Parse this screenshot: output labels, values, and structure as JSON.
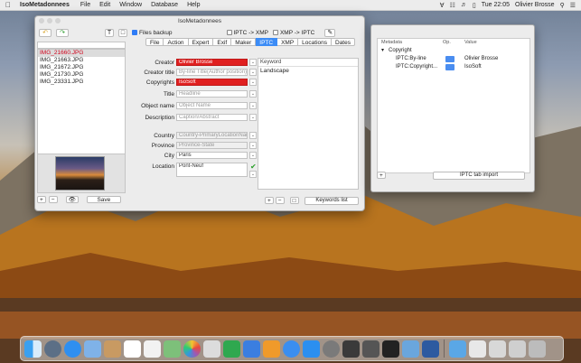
{
  "menubar": {
    "app_name": "IsoMetadonnees",
    "items": [
      "File",
      "Edit",
      "Window",
      "Database",
      "Help"
    ],
    "clock": "Tue 22:05",
    "user": "Olivier Brosse"
  },
  "main_window": {
    "title": "IsoMetadonnees",
    "files_backup_label": "Files backup",
    "iptc_to_xmp_label": "IPTC -> XMP",
    "xmp_to_iptc_label": "XMP -> IPTC",
    "files": [
      "IMG_21660.JPG",
      "IMG_21663.JPG",
      "IMG_21672.JPG",
      "IMG_21730.JPG",
      "IMG_23331.JPG"
    ],
    "save_label": "Save",
    "tabs": [
      "File",
      "Action",
      "Expert",
      "Exif",
      "Maker",
      "IPTC",
      "XMP",
      "Locations",
      "Dates"
    ],
    "active_tab": "IPTC",
    "fields": {
      "creator_label": "Creator",
      "creator_value": "Olivier Brosse",
      "creator_title_label": "Creator title",
      "creator_title_placeholder": "By-line Title(Author position)",
      "copyrights_label": "Copyrights",
      "copyrights_value": "IsoSoft",
      "title_label": "Title",
      "title_placeholder": "Headline",
      "object_name_label": "Object name",
      "object_name_placeholder": "Object Name",
      "description_label": "Description",
      "description_placeholder": "Caption/Abstract",
      "country_label": "Country",
      "country_placeholder": "Country-PrimaryLocationName",
      "province_label": "Province",
      "province_placeholder": "Province-State",
      "city_label": "City",
      "city_value": "Paris",
      "location_label": "Location",
      "location_value": "Pont-Neuf"
    },
    "keywords_header": "Keyword",
    "keywords": [
      "Landscape"
    ],
    "keywords_list_label": "Keywords list"
  },
  "side_window": {
    "col_metadata": "Metadata",
    "col_op": "Op.",
    "col_value": "Value",
    "group": "Copyright",
    "rows": [
      {
        "key": "IPTC:By-line",
        "value": "Olivier Brosse"
      },
      {
        "key": "IPTC:Copyright...",
        "value": "IsoSoft"
      }
    ],
    "import_label": "IPTC tab import"
  },
  "colors": {
    "accent": "#3c8cf6",
    "required_field": "#e02020"
  }
}
